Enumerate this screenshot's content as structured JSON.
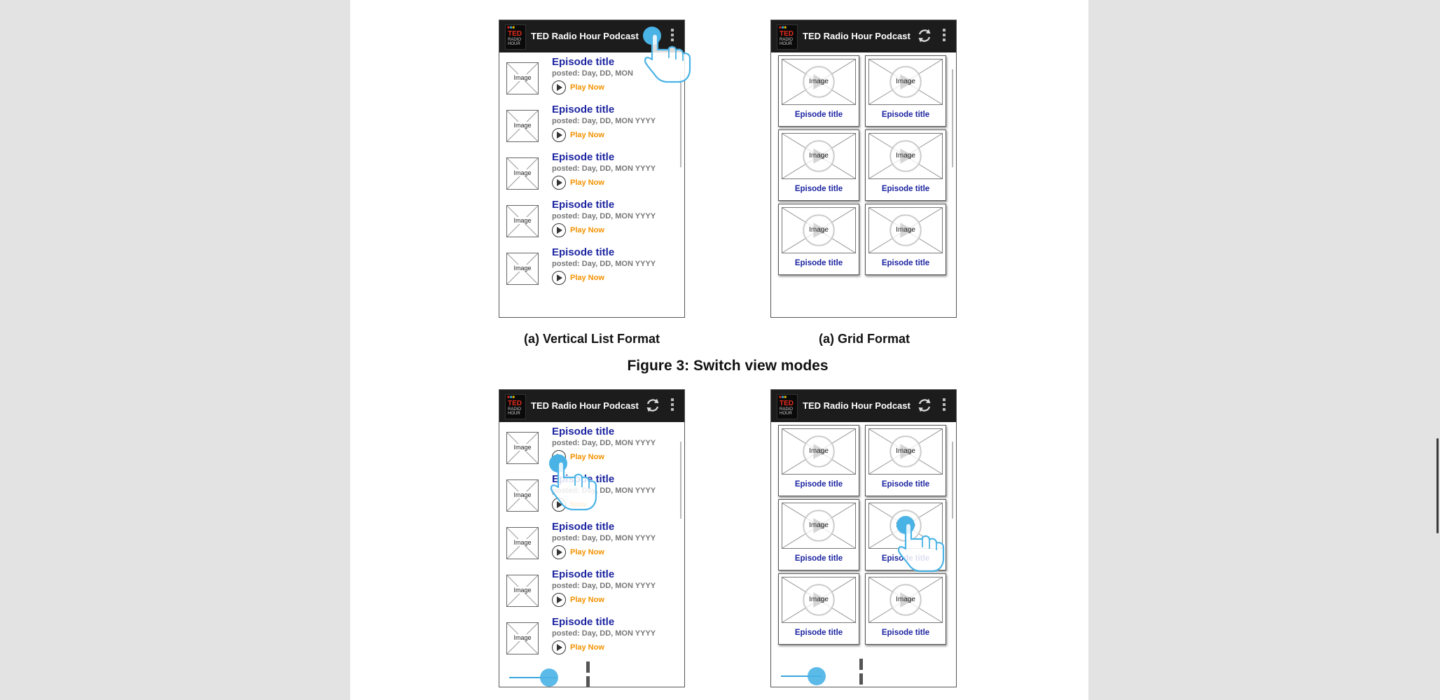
{
  "app": {
    "title": "TED Radio Hour Podcast",
    "logo_text": "TED",
    "logo_sub": "RADIO HOUR"
  },
  "captions": {
    "list_format": "(a) Vertical List Format",
    "grid_format": "(a) Grid Format",
    "figure_title": "Figure 3: Switch view modes"
  },
  "list_items": [
    {
      "title": "Episode title",
      "posted": "posted: Day, DD, MON",
      "thumb": "Image",
      "play": "Play Now"
    },
    {
      "title": "Episode title",
      "posted": "posted: Day, DD, MON YYYY",
      "thumb": "Image",
      "play": "Play Now"
    },
    {
      "title": "Episode title",
      "posted": "posted: Day, DD, MON YYYY",
      "thumb": "Image",
      "play": "Play Now"
    },
    {
      "title": "Episode title",
      "posted": "posted: Day, DD, MON YYYY",
      "thumb": "Image",
      "play": "Play Now"
    },
    {
      "title": "Episode title",
      "posted": "posted: Day, DD, MON YYYY",
      "thumb": "Image",
      "play": "Play Now"
    }
  ],
  "list_items_2": [
    {
      "title": "Episode title",
      "posted": "posted: Day, DD, MON YYYY",
      "thumb": "Image",
      "play": "Play Now"
    },
    {
      "title": "Episode title",
      "posted": "posted: Day, DD, MON YYYY",
      "thumb": "Image",
      "play": "Now"
    },
    {
      "title": "Episode title",
      "posted": "posted: Day, DD, MON YYYY",
      "thumb": "Image",
      "play": "Play Now"
    },
    {
      "title": "Episode title",
      "posted": "posted: Day, DD, MON YYYY",
      "thumb": "Image",
      "play": "Play Now"
    },
    {
      "title": "Episode title",
      "posted": "posted: Day, DD, MON YYYY",
      "thumb": "Image",
      "play": "Play Now"
    }
  ],
  "grid_items": [
    {
      "title": "Episode title",
      "thumb": "Image"
    },
    {
      "title": "Episode title",
      "thumb": "Image"
    },
    {
      "title": "Episode title",
      "thumb": "Image"
    },
    {
      "title": "Episode title",
      "thumb": "Image"
    },
    {
      "title": "Episode title",
      "thumb": "Image"
    },
    {
      "title": "Episode title",
      "thumb": "Image"
    }
  ],
  "colors": {
    "appbar": "#1c1c1c",
    "episode_title": "#1c24a0",
    "play_now": "#f39200",
    "touch": "#4ab3e6"
  },
  "icons": {
    "refresh": "refresh-icon",
    "overflow": "overflow-menu-icon",
    "play": "play-icon",
    "pause": "pause-icon",
    "touch": "hand-tap-icon"
  }
}
